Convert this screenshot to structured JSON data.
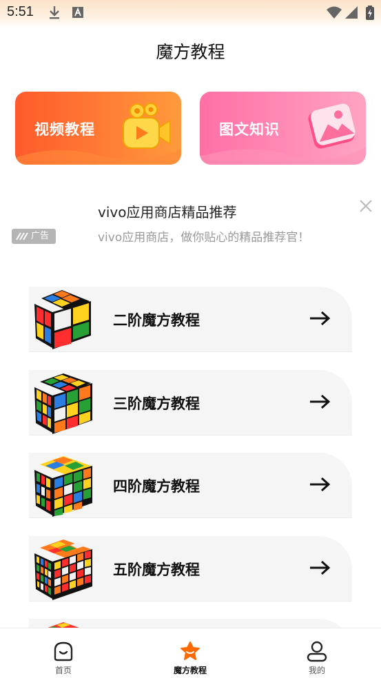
{
  "status": {
    "time": "5:51"
  },
  "header": {
    "title": "魔方教程"
  },
  "banners": [
    {
      "label": "视频教程",
      "icon": "video-camera-icon"
    },
    {
      "label": "图文知识",
      "icon": "image-icon"
    }
  ],
  "ad": {
    "badge": "广告",
    "title": "vivo应用商店精品推荐",
    "description": "vivo应用商店，做你贴心的精品推荐官！"
  },
  "tutorials": [
    {
      "label": "二阶魔方教程",
      "order": 2
    },
    {
      "label": "三阶魔方教程",
      "order": 3
    },
    {
      "label": "四阶魔方教程",
      "order": 4
    },
    {
      "label": "五阶魔方教程",
      "order": 5
    }
  ],
  "nav": {
    "items": [
      {
        "label": "首页",
        "icon": "home-smile-icon"
      },
      {
        "label": "魔方教程",
        "icon": "cube-tutorial-icon"
      },
      {
        "label": "我的",
        "icon": "user-icon"
      }
    ],
    "active_index": 1
  },
  "colors": {
    "accent": "#ff6a00",
    "video_banner": "#ff6b2f",
    "image_banner": "#ff7fae"
  }
}
